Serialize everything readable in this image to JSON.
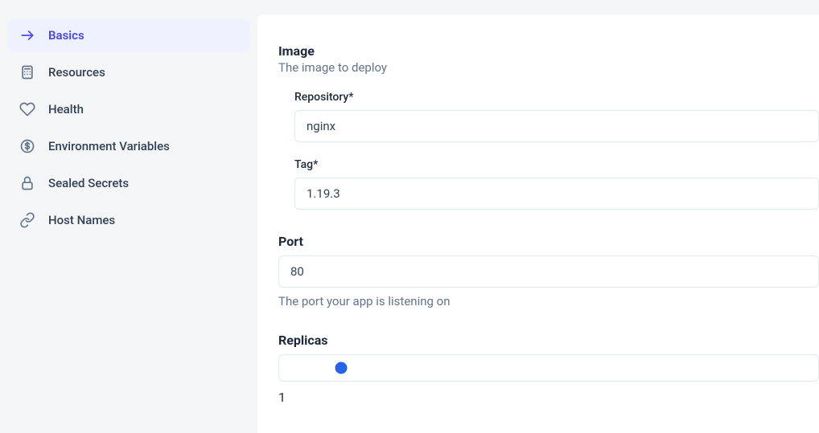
{
  "sidebar": {
    "items": [
      {
        "label": "Basics"
      },
      {
        "label": "Resources"
      },
      {
        "label": "Health"
      },
      {
        "label": "Environment Variables"
      },
      {
        "label": "Sealed Secrets"
      },
      {
        "label": "Host Names"
      }
    ]
  },
  "form": {
    "image": {
      "title": "Image",
      "desc": "The image to deploy",
      "repository_label": "Repository*",
      "repository_value": "nginx",
      "tag_label": "Tag*",
      "tag_value": "1.19.3"
    },
    "port": {
      "title": "Port",
      "value": "80",
      "help": "The port your app is listening on"
    },
    "replicas": {
      "title": "Replicas",
      "value": "1"
    }
  }
}
